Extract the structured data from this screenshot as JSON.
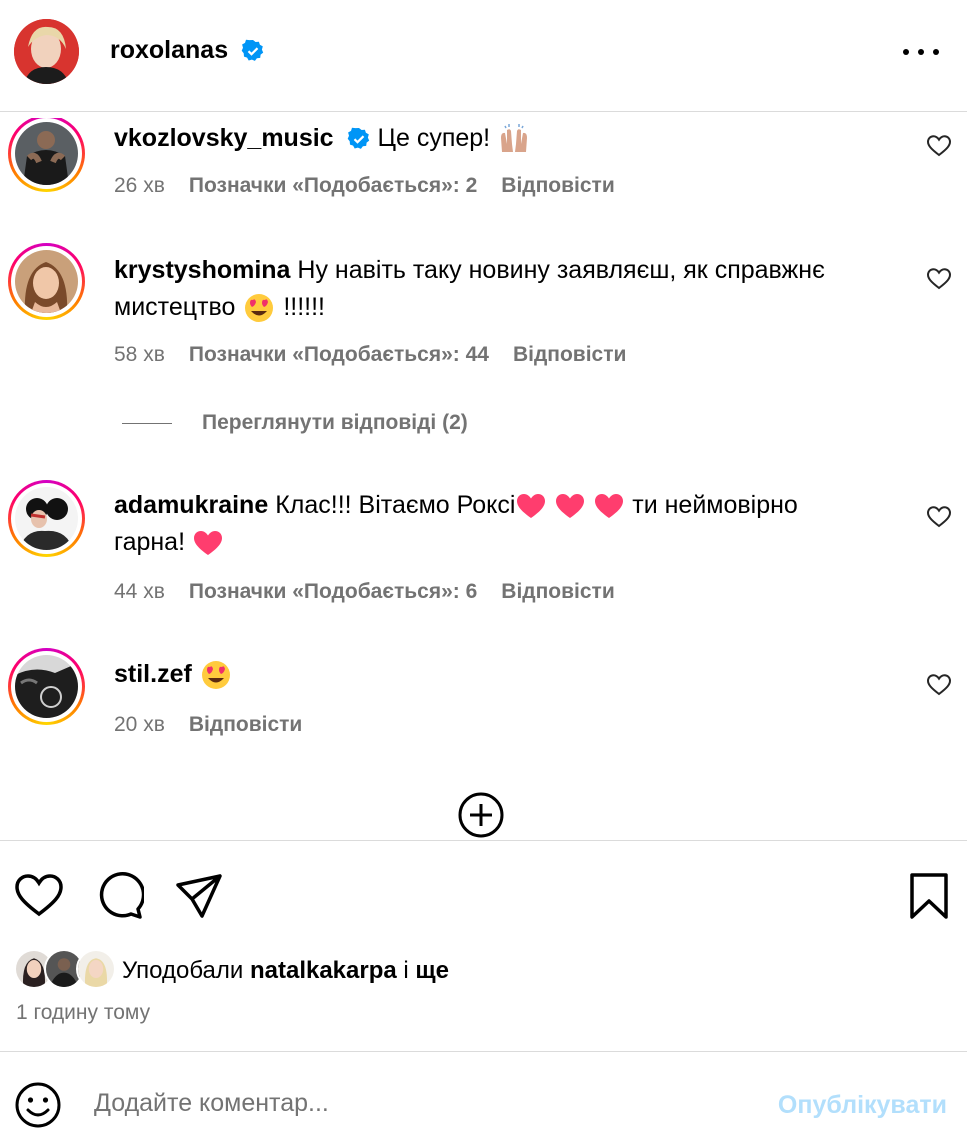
{
  "header": {
    "username": "roxolanas"
  },
  "comments": [
    {
      "username": "vkozlovsky_music",
      "text": "Це супер!",
      "time": "26 хв",
      "likes": "Позначки «Подобається»: 2",
      "reply": "Відповісти"
    },
    {
      "username": "krystyshomina",
      "text_line1": "Ну навіть таку новину заявляєш, як справжнє",
      "text_line2": "мистецтво",
      "text_tail": "!!!!!!",
      "time": "58 хв",
      "likes": "Позначки «Подобається»: 44",
      "reply": "Відповісти"
    },
    {
      "username": "adamukraine",
      "text_line1": "Клас!!! Вітаємо Роксі",
      "text_mid": "ти неймовірно",
      "text_line2": "гарна!",
      "time": "44 хв",
      "likes": "Позначки «Подобається»: 6",
      "reply": "Відповісти"
    },
    {
      "username": "stil.zef",
      "time": "20 хв",
      "reply": "Відповісти"
    }
  ],
  "view_replies": "Переглянути відповіді (2)",
  "actions": {
    "liked_prefix": "Уподобали",
    "liked_by": "natalkakarpa",
    "liked_and": "і",
    "liked_more": "ще",
    "time_ago": "1 годину тому"
  },
  "add_comment": {
    "placeholder": "Додайте коментар...",
    "post_label": "Опублікувати"
  },
  "colors": {
    "accent": "#0095f6",
    "post_disabled": "#b2dffc",
    "meta": "#737373",
    "heart_emoji": "#ff3d6e",
    "verified": "#0095f6"
  }
}
